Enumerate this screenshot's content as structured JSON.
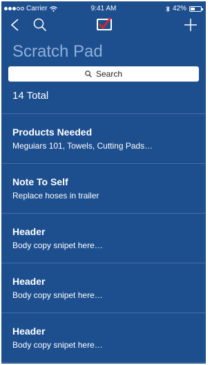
{
  "status_bar": {
    "carrier": "Carrier",
    "time": "9:41 AM",
    "battery_percent": "42%",
    "battery_level": 0.42
  },
  "nav": {
    "back_icon": "chevron-left-icon",
    "search_icon": "search-icon",
    "logo_icon": "checkmark-logo-icon",
    "add_icon": "plus-icon"
  },
  "page": {
    "title": "Scratch Pad"
  },
  "search": {
    "label": "Search"
  },
  "summary": {
    "total": "14 Total"
  },
  "notes": [
    {
      "title": "Products Needed",
      "body": "Meguiars 101, Towels, Cutting Pads…"
    },
    {
      "title": "Note To Self",
      "body": "Replace hoses in trailer"
    },
    {
      "title": "Header",
      "body": "Body copy snipet here…"
    },
    {
      "title": "Header",
      "body": "Body copy snipet here…"
    },
    {
      "title": "Header",
      "body": "Body copy snipet here…"
    }
  ],
  "colors": {
    "background": "#1d4f8f",
    "title": "#8fb0d8",
    "text": "#ffffff",
    "logo_red": "#d8232a"
  }
}
